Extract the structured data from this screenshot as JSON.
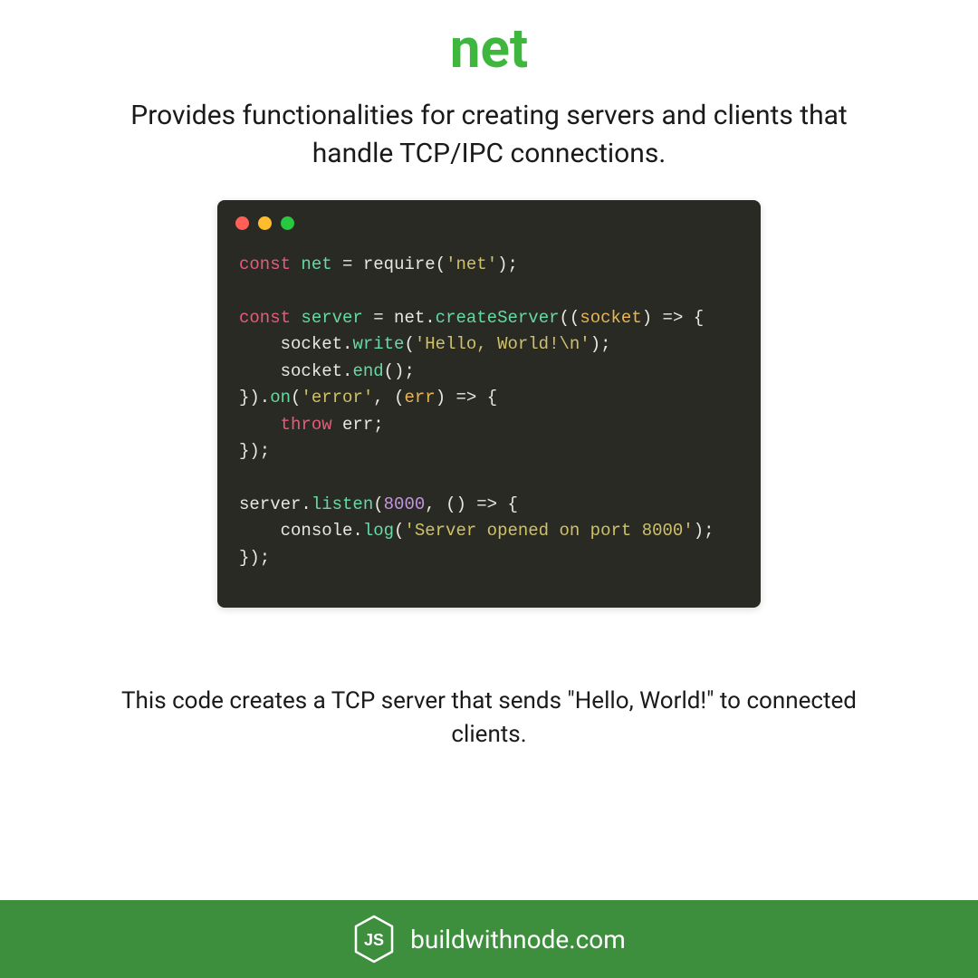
{
  "title": "net",
  "description": "Provides functionalities for creating servers and clients that handle TCP/IPC connections.",
  "caption": "This code creates a TCP server that sends \"Hello, World!\" to connected clients.",
  "footer": {
    "site": "buildwithnode.com"
  },
  "code": {
    "tokens": [
      {
        "t": "const",
        "c": "kw"
      },
      {
        "t": " ",
        "c": "plain"
      },
      {
        "t": "net",
        "c": "method"
      },
      {
        "t": " = ",
        "c": "plain"
      },
      {
        "t": "require",
        "c": "var"
      },
      {
        "t": "(",
        "c": "plain"
      },
      {
        "t": "'net'",
        "c": "str"
      },
      {
        "t": ");",
        "c": "plain"
      },
      {
        "t": "\n\n",
        "c": "plain"
      },
      {
        "t": "const",
        "c": "kw"
      },
      {
        "t": " ",
        "c": "plain"
      },
      {
        "t": "server",
        "c": "method"
      },
      {
        "t": " = net.",
        "c": "plain"
      },
      {
        "t": "createServer",
        "c": "method"
      },
      {
        "t": "((",
        "c": "plain"
      },
      {
        "t": "socket",
        "c": "param"
      },
      {
        "t": ") => {\n",
        "c": "plain"
      },
      {
        "t": "    socket.",
        "c": "plain"
      },
      {
        "t": "write",
        "c": "method"
      },
      {
        "t": "(",
        "c": "plain"
      },
      {
        "t": "'Hello, World!\\n'",
        "c": "str"
      },
      {
        "t": ");\n",
        "c": "plain"
      },
      {
        "t": "    socket.",
        "c": "plain"
      },
      {
        "t": "end",
        "c": "method"
      },
      {
        "t": "();\n",
        "c": "plain"
      },
      {
        "t": "}).",
        "c": "plain"
      },
      {
        "t": "on",
        "c": "method"
      },
      {
        "t": "(",
        "c": "plain"
      },
      {
        "t": "'error'",
        "c": "str"
      },
      {
        "t": ", (",
        "c": "plain"
      },
      {
        "t": "err",
        "c": "param"
      },
      {
        "t": ") => {\n",
        "c": "plain"
      },
      {
        "t": "    ",
        "c": "plain"
      },
      {
        "t": "throw",
        "c": "kw"
      },
      {
        "t": " err;\n",
        "c": "plain"
      },
      {
        "t": "});\n\n",
        "c": "plain"
      },
      {
        "t": "server.",
        "c": "plain"
      },
      {
        "t": "listen",
        "c": "method"
      },
      {
        "t": "(",
        "c": "plain"
      },
      {
        "t": "8000",
        "c": "num"
      },
      {
        "t": ", () => {\n",
        "c": "plain"
      },
      {
        "t": "    console.",
        "c": "plain"
      },
      {
        "t": "log",
        "c": "method"
      },
      {
        "t": "(",
        "c": "plain"
      },
      {
        "t": "'Server opened on port 8000'",
        "c": "str"
      },
      {
        "t": ");\n",
        "c": "plain"
      },
      {
        "t": "});",
        "c": "plain"
      }
    ]
  }
}
